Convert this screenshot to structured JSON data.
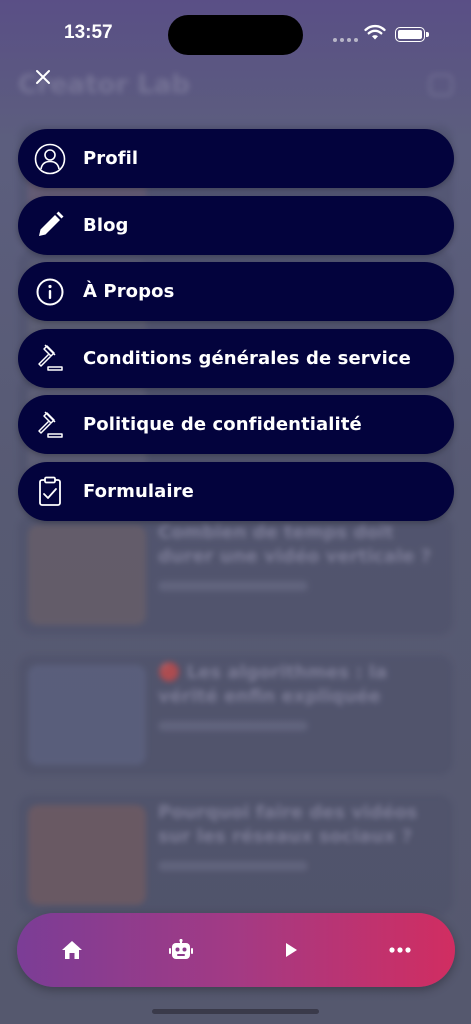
{
  "status": {
    "time": "13:57"
  },
  "menu": {
    "items": [
      {
        "label": "Profil",
        "icon": "user-icon"
      },
      {
        "label": "Blog",
        "icon": "pencil-icon"
      },
      {
        "label": "À Propos",
        "icon": "info-icon"
      },
      {
        "label": "Conditions générales de service",
        "icon": "gavel-icon"
      },
      {
        "label": "Politique de confidentialité",
        "icon": "gavel-icon"
      },
      {
        "label": "Formulaire",
        "icon": "clipboard-check-icon"
      }
    ]
  },
  "background": {
    "title": "Creator Lab",
    "articles": [
      {
        "title": "Combien de temps doit durer une vidéo verticale ?"
      },
      {
        "title": "🔴 Les algorithmes : la vérité enfin expliquée"
      },
      {
        "title": "Pourquoi faire des vidéos sur les réseaux sociaux ?"
      }
    ]
  },
  "tab_bar": {
    "tabs": [
      {
        "icon": "home-icon"
      },
      {
        "icon": "robot-icon"
      },
      {
        "icon": "play-icon"
      },
      {
        "icon": "more-icon"
      }
    ]
  },
  "colors": {
    "menu_item_bg": "#03033d",
    "tab_bar_gradient_start": "#7b3d96",
    "tab_bar_gradient_end": "#d12d61"
  }
}
